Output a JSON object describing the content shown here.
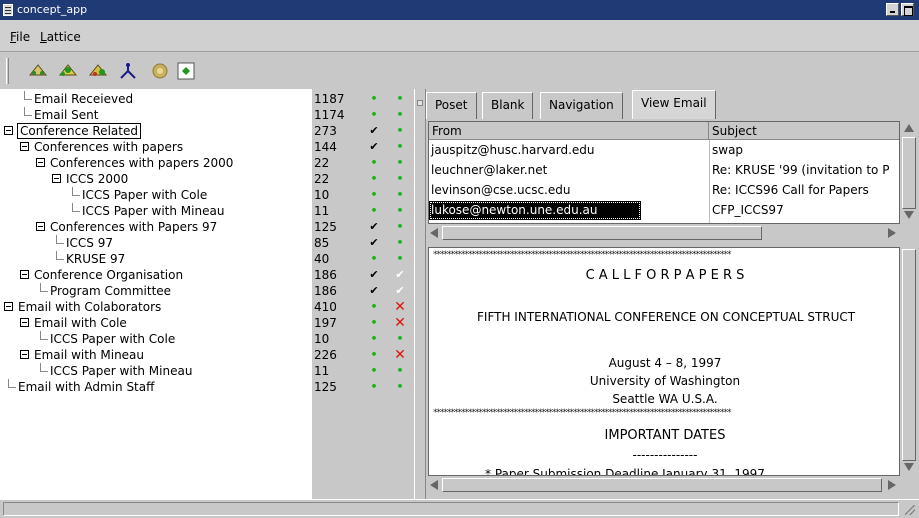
{
  "window": {
    "title": "concept_app"
  },
  "menu": {
    "file": "File",
    "lattice": "Lattice"
  },
  "toolbar": {
    "icons": [
      "lattice-icon-1",
      "lattice-icon-2",
      "lattice-icon-3",
      "graph-icon",
      "target-icon",
      "diamond-icon"
    ]
  },
  "tree": {
    "rows": [
      {
        "label": "Email Receieved",
        "count": "1187",
        "m1": "dot",
        "m2": "dot"
      },
      {
        "label": "Email Sent",
        "count": "1174",
        "m1": "dot",
        "m2": "dot"
      },
      {
        "label": "Conference Related",
        "count": "273",
        "m1": "check",
        "m2": "dot"
      },
      {
        "label": "Conferences with papers",
        "count": "144",
        "m1": "check",
        "m2": "dot"
      },
      {
        "label": "Conferences with papers 2000",
        "count": "22",
        "m1": "dot",
        "m2": "dot"
      },
      {
        "label": "ICCS 2000",
        "count": "22",
        "m1": "dot",
        "m2": "dot"
      },
      {
        "label": "ICCS Paper with Cole",
        "count": "10",
        "m1": "dot",
        "m2": "dot"
      },
      {
        "label": "ICCS Paper with Mineau",
        "count": "11",
        "m1": "dot",
        "m2": "dot"
      },
      {
        "label": "Conferences with Papers 97",
        "count": "125",
        "m1": "check",
        "m2": "dot"
      },
      {
        "label": "ICCS 97",
        "count": "85",
        "m1": "check",
        "m2": "dot"
      },
      {
        "label": "KRUSE 97",
        "count": "40",
        "m1": "dot",
        "m2": "dot"
      },
      {
        "label": "Conference Organisation",
        "count": "186",
        "m1": "check",
        "m2": "checkw"
      },
      {
        "label": "Program Committee",
        "count": "186",
        "m1": "check",
        "m2": "checkw"
      },
      {
        "label": "Email with Colaborators",
        "count": "410",
        "m1": "dot",
        "m2": "cross"
      },
      {
        "label": "Email with Cole",
        "count": "197",
        "m1": "dot",
        "m2": "cross"
      },
      {
        "label": "ICCS Paper with Cole",
        "count": "10",
        "m1": "dot",
        "m2": "dot"
      },
      {
        "label": "Email with Mineau",
        "count": "226",
        "m1": "dot",
        "m2": "cross"
      },
      {
        "label": "ICCS Paper with Mineau",
        "count": "11",
        "m1": "dot",
        "m2": "dot"
      },
      {
        "label": "Email with Admin Staff",
        "count": "125",
        "m1": "dot",
        "m2": "dot"
      }
    ]
  },
  "tabs": [
    "Poset",
    "Blank",
    "Navigation",
    "View Email"
  ],
  "email_table": {
    "columns": [
      "From",
      "Subject"
    ],
    "rows": [
      {
        "from": "jauspitz@husc.harvard.edu",
        "subject": "swap"
      },
      {
        "from": "leuchner@laker.net",
        "subject": "Re: KRUSE '99 (invitation to P"
      },
      {
        "from": "levinson@cse.ucsc.edu",
        "subject": "Re:  ICCS96 Call for Papers"
      },
      {
        "from": "lukose@newton.une.edu.au",
        "subject": "CFP_ICCS97"
      }
    ]
  },
  "email_body": {
    "stars": "*************************************************************************************",
    "heading": "C A L L   F O R   P A P E R S",
    "conference": "FIFTH INTERNATIONAL CONFERENCE ON CONCEPTUAL STRUCT",
    "dates": "August 4 – 8, 1997",
    "venue": "University of Washington",
    "city": "Seattle WA U.S.A.",
    "important": "IMPORTANT DATES",
    "dashes": "---------------",
    "partial": "* Paper Submission Deadline      January 31, 1997"
  },
  "colors": {
    "titlebar": "#1f3a75",
    "dot": "#16b816",
    "cross": "#e01010",
    "selection": "#000000"
  }
}
